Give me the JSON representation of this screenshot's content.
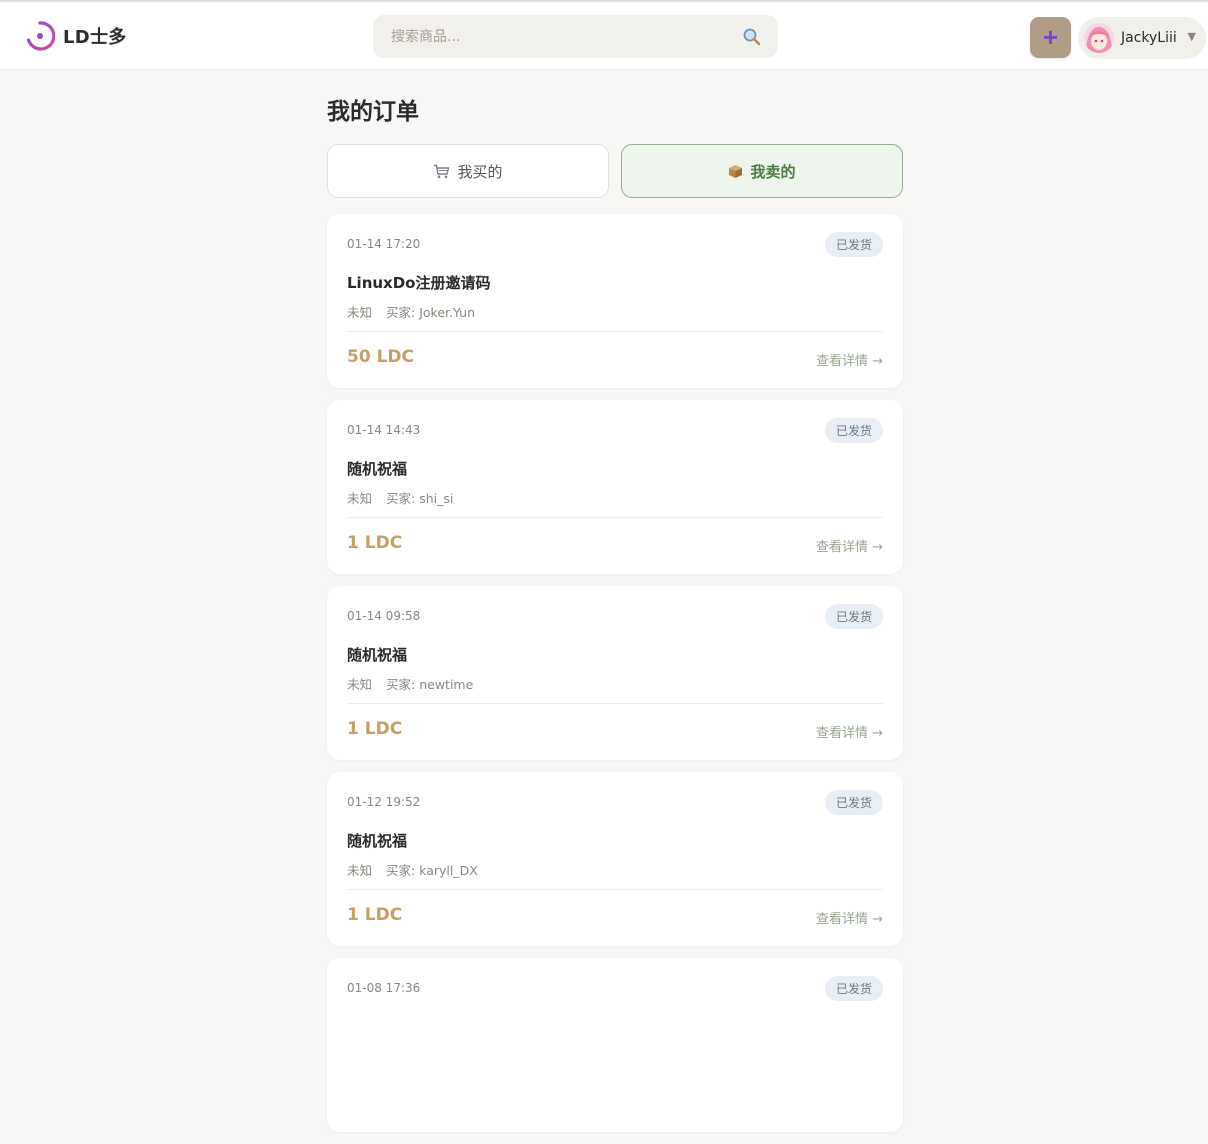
{
  "brand": {
    "name": "LD士多"
  },
  "search": {
    "placeholder": "搜索商品..."
  },
  "user": {
    "name": "JackyLiii"
  },
  "page": {
    "title": "我的订单"
  },
  "tabs": [
    {
      "label": "我买的",
      "icon": "shopping-cart-icon",
      "active": false
    },
    {
      "label": "我卖的",
      "icon": "package-icon",
      "active": true
    }
  ],
  "orders": [
    {
      "time": "01-14 17:20",
      "status": "已发货",
      "title": "LinuxDo注册邀请码",
      "tag": "未知",
      "buyer": "买家: Joker.Yun",
      "price": "50 LDC",
      "link": "查看详情 →"
    },
    {
      "time": "01-14 14:43",
      "status": "已发货",
      "title": "随机祝福",
      "tag": "未知",
      "buyer": "买家: shi_si",
      "price": "1 LDC",
      "link": "查看详情 →"
    },
    {
      "time": "01-14 09:58",
      "status": "已发货",
      "title": "随机祝福",
      "tag": "未知",
      "buyer": "买家: newtime",
      "price": "1 LDC",
      "link": "查看详情 →"
    },
    {
      "time": "01-12 19:52",
      "status": "已发货",
      "title": "随机祝福",
      "tag": "未知",
      "buyer": "买家: karyll_DX",
      "price": "1 LDC",
      "link": "查看详情 →"
    },
    {
      "time": "01-08 17:36",
      "status": "已发货"
    }
  ],
  "colors": {
    "accent_green": "#4f7a47",
    "price": "#c89d66",
    "add_button": "#b09d87",
    "status_badge_bg": "#e8eef3"
  }
}
